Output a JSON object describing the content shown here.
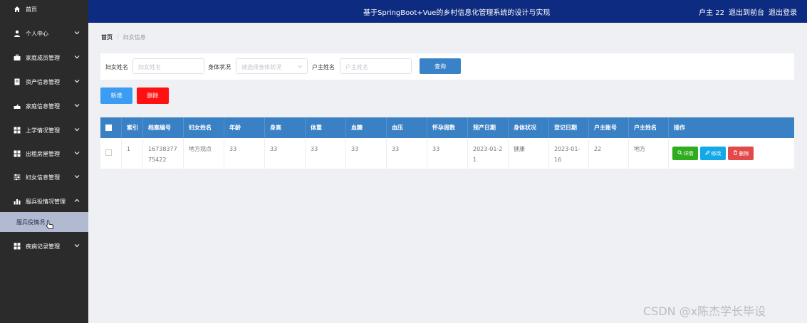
{
  "sidebar": {
    "items": [
      {
        "label": "首页",
        "icon": "home-icon"
      },
      {
        "label": "个人中心",
        "icon": "user-icon"
      },
      {
        "label": "家庭成员管理",
        "icon": "briefcase-icon"
      },
      {
        "label": "资产信息管理",
        "icon": "document-icon"
      },
      {
        "label": "家庭信息管理",
        "icon": "hand-icon"
      },
      {
        "label": "上学情况管理",
        "icon": "grid-icon"
      },
      {
        "label": "出租房屋管理",
        "icon": "grid-icon"
      },
      {
        "label": "妇女信息管理",
        "icon": "sliders-icon"
      },
      {
        "label": "服兵役情况管理",
        "icon": "bar-chart-icon"
      },
      {
        "label": "疾病记录管理",
        "icon": "grid-icon"
      }
    ],
    "sub_item": "服兵役情况"
  },
  "header": {
    "title": "基于SpringBoot+Vue的乡村信息化管理系统的设计与实现",
    "user": "户主 22",
    "back_to_front": "退出到前台",
    "logout": "退出登录"
  },
  "breadcrumb": {
    "home": "首页",
    "current": "妇女信息"
  },
  "search": {
    "name_label": "妇女姓名",
    "name_placeholder": "妇女姓名",
    "health_label": "身体状况",
    "health_placeholder": "请选择身体状况",
    "owner_label": "户主姓名",
    "owner_placeholder": "户主姓名",
    "query_button": "查询"
  },
  "actions": {
    "add": "新增",
    "delete": "删除"
  },
  "table": {
    "columns": [
      "索引",
      "档案编号",
      "妇女姓名",
      "年龄",
      "身高",
      "体重",
      "血糖",
      "血压",
      "怀孕周数",
      "预产日期",
      "身体状况",
      "登记日期",
      "户主账号",
      "户主姓名",
      "操作"
    ],
    "rows": [
      {
        "cells": [
          "1",
          "1673837775422",
          "地方观点",
          "33",
          "33",
          "33",
          "33",
          "33",
          "33",
          "2023-01-21",
          "健康",
          "2023-01-16",
          "22",
          "地方"
        ],
        "ops": {
          "detail": "详情",
          "edit": "修改",
          "delete": "删除"
        }
      }
    ]
  },
  "watermark": "CSDN @x陈杰学长毕设",
  "colors": {
    "header_bg": "#0d2b80",
    "sidebar_bg": "#2b2b2b",
    "table_header": "#3a80c5",
    "add": "#3a9cf2",
    "delete": "#ff1111",
    "detail": "#2fad1f",
    "edit": "#13a9e8",
    "row_delete": "#e34949"
  }
}
